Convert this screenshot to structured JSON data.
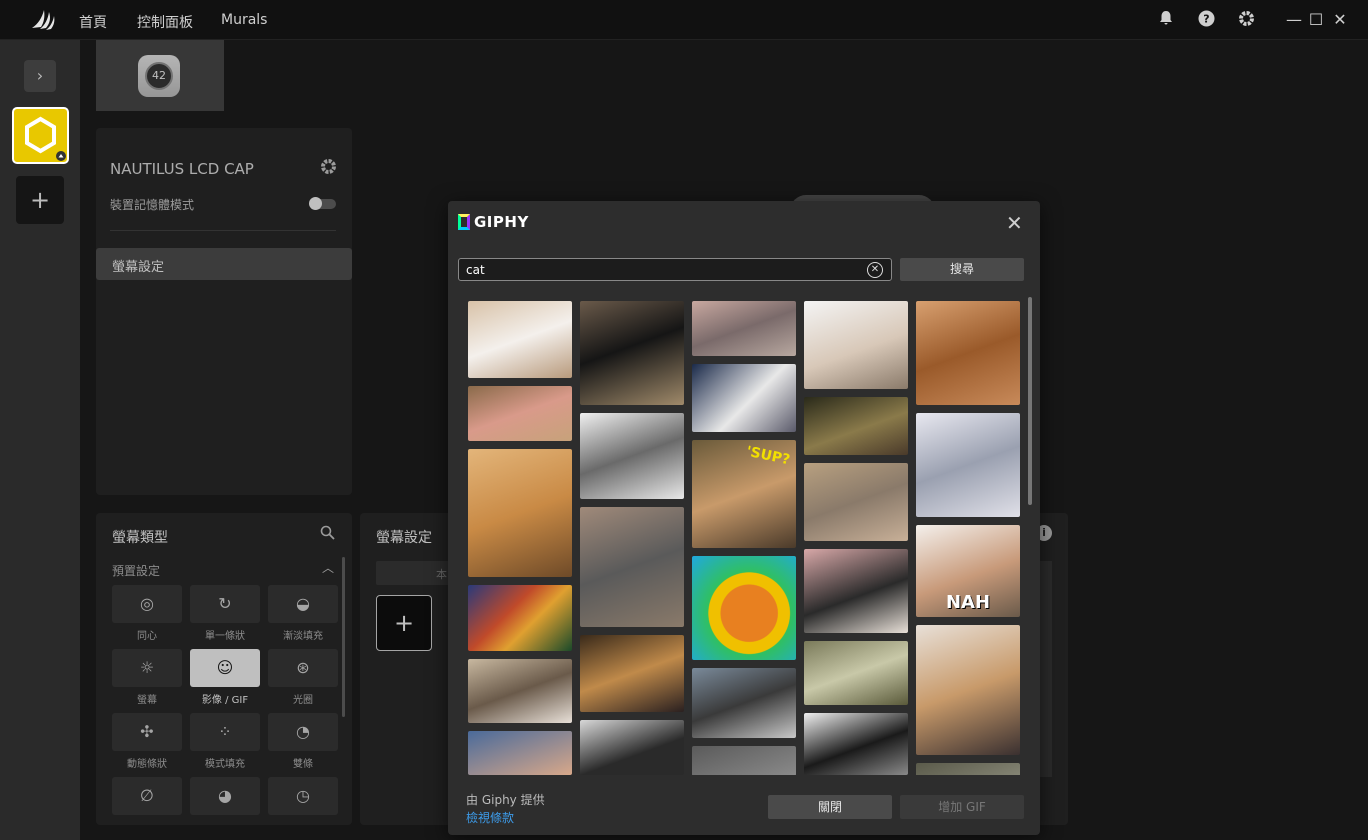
{
  "titlebar": {
    "nav": [
      "首頁",
      "控制面板",
      "Murals"
    ],
    "icons": [
      "bell-icon",
      "help-icon",
      "gear-icon"
    ],
    "window_controls": [
      "minimize-icon",
      "maximize-icon",
      "close-icon"
    ]
  },
  "device_tab": {
    "dial_value": "42"
  },
  "device_panel": {
    "title": "NAUTILUS LCD CAP",
    "memory_mode_label": "裝置記憶體模式",
    "memory_mode_on": false,
    "menu_item": "螢幕設定"
  },
  "screen_type_panel": {
    "title": "螢幕類型",
    "preset_label": "預置設定",
    "types": [
      {
        "label": "同心",
        "icon": "concentric-icon",
        "glyph": "◎"
      },
      {
        "label": "單一條狀",
        "icon": "single-bar-icon",
        "glyph": "↻"
      },
      {
        "label": "漸淡填充",
        "icon": "fade-fill-icon",
        "glyph": "◒"
      },
      {
        "label": "螢幕",
        "icon": "screen-icon",
        "glyph": "☼"
      },
      {
        "label": "影像 / GIF",
        "icon": "image-gif-icon",
        "glyph": "☺"
      },
      {
        "label": "光圈",
        "icon": "aperture-icon",
        "glyph": "⊛"
      },
      {
        "label": "動態條狀",
        "icon": "dynamic-bar-icon",
        "glyph": "✣"
      },
      {
        "label": "模式填充",
        "icon": "pattern-fill-icon",
        "glyph": "⁘"
      },
      {
        "label": "雙條",
        "icon": "dual-bar-icon",
        "glyph": "◔"
      },
      {
        "label": "",
        "icon": "none-icon",
        "glyph": "∅"
      },
      {
        "label": "",
        "icon": "pie-icon",
        "glyph": "◕"
      },
      {
        "label": "",
        "icon": "clock-icon",
        "glyph": "◷"
      }
    ],
    "selected_index": 4
  },
  "screen_settings_panel": {
    "title": "螢幕設定",
    "segment_label": "本"
  },
  "giphy_modal": {
    "brand": "GIPHY",
    "search_value": "cat",
    "search_button": "搜尋",
    "credit": "由 Giphy 提供",
    "terms_link": "檢視條款",
    "close_button": "關閉",
    "add_gif_button": "增加 GIF",
    "gif_captions": {
      "sup": "'SUP?",
      "nah": "NAH"
    }
  }
}
